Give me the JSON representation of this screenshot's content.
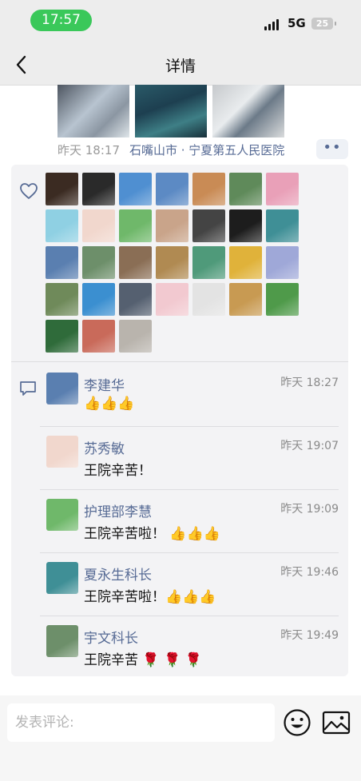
{
  "status_bar": {
    "time": "17:57",
    "network": "5G",
    "battery": "25"
  },
  "nav": {
    "title": "详情"
  },
  "post": {
    "time": "昨天 18:17",
    "location": "石嘴山市 · 宁夏第五人民医院",
    "more": "••"
  },
  "likes": {
    "avatar_colors": [
      "#3b2b22",
      "#2a2a2a",
      "#4f8fd1",
      "#5c8ac4",
      "#c98b55",
      "#5f8a5a",
      "#e9a0b8",
      "#8fd0e3",
      "#f1d7cd",
      "#6fb86a",
      "#c9a48a",
      "#444444",
      "#1d1d1d",
      "#3f8f96",
      "#5a7fb0",
      "#6d8f6a",
      "#8a6e55",
      "#b08a52",
      "#4f9a7a",
      "#e0b23a",
      "#9fa8d8",
      "#6f8a5a",
      "#3b8fd0",
      "#556070",
      "#f2c9d0",
      "#e3e3e3",
      "#c89a52",
      "#4f9a4a",
      "#2f6b3a",
      "#c96a5a",
      "#b9b4ad"
    ]
  },
  "comments": [
    {
      "name": "李建华",
      "time": "昨天 18:27",
      "text": "👍👍👍",
      "avatar_color": "#5a7fb0"
    },
    {
      "name": "苏秀敏",
      "time": "昨天 19:07",
      "text": "王院辛苦！",
      "avatar_color": "#f1d7cd"
    },
    {
      "name": "护理部李慧",
      "time": "昨天 19:09",
      "text": "王院辛苦啦！ 👍👍👍",
      "avatar_color": "#6fb86a"
    },
    {
      "name": "夏永生科长",
      "time": "昨天 19:46",
      "text": "王院辛苦啦！👍👍👍",
      "avatar_color": "#3f8f96"
    },
    {
      "name": "宇文科长",
      "time": "昨天 19:49",
      "text": "王院辛苦 🌹 🌹 🌹",
      "avatar_color": "#6d8f6a"
    }
  ],
  "composer": {
    "placeholder": "发表评论:"
  }
}
